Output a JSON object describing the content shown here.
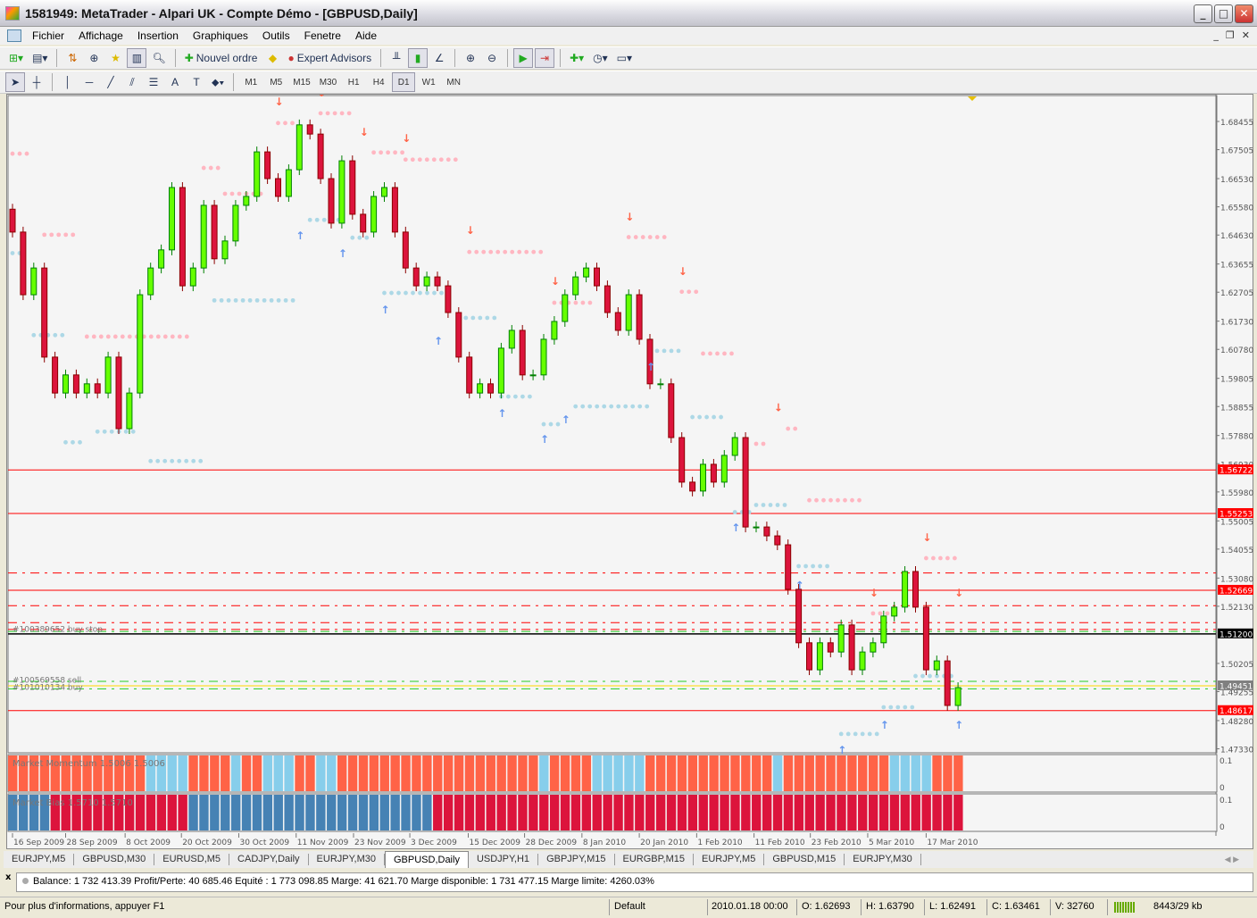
{
  "window": {
    "title": "1581949: MetaTrader - Alpari UK - Compte Démo - [GBPUSD,Daily]"
  },
  "menu": [
    "Fichier",
    "Affichage",
    "Insertion",
    "Graphiques",
    "Outils",
    "Fenetre",
    "Aide"
  ],
  "toolbar": {
    "new_order": "Nouvel ordre",
    "expert_advisors": "Expert Advisors"
  },
  "timeframes": [
    "M1",
    "M5",
    "M15",
    "M30",
    "H1",
    "H4",
    "D1",
    "W1",
    "MN"
  ],
  "active_timeframe": "D1",
  "colors": {
    "bull": "#66ff00",
    "bear": "#dc143c",
    "resistance": "#ffb6c1",
    "support": "#add8e6",
    "down_arrow": "#ff6347",
    "up_arrow": "#6495ed",
    "momentum_bear": "#ff6347",
    "momentum_bull": "#87ceeb",
    "bias_bear": "#dc143c",
    "bias_bull": "#4682b4"
  },
  "chart_data": {
    "type": "candlestick",
    "symbol": "GBPUSD",
    "period": "Daily",
    "closes": [
      1.6473,
      1.6262,
      1.6352,
      1.6052,
      1.5931,
      1.5992,
      1.5931,
      1.5962,
      1.5931,
      1.6052,
      1.5811,
      1.5931,
      1.6262,
      1.6352,
      1.6413,
      1.6623,
      1.6292,
      1.6352,
      1.6563,
      1.6383,
      1.6443,
      1.6563,
      1.6593,
      1.6743,
      1.6653,
      1.6593,
      1.6683,
      1.6834,
      1.6803,
      1.6653,
      1.6503,
      1.6713,
      1.6533,
      1.6473,
      1.6593,
      1.6623,
      1.6473,
      1.6352,
      1.6292,
      1.6322,
      1.6292,
      1.6202,
      1.6052,
      1.5931,
      1.5962,
      1.5931,
      1.6082,
      1.6142,
      1.5992,
      1.5992,
      1.6112,
      1.6172,
      1.6262,
      1.6322,
      1.6352,
      1.6292,
      1.6202,
      1.6142,
      1.6262,
      1.6112,
      1.5962,
      1.5962,
      1.5781,
      1.5631,
      1.5601,
      1.5691,
      1.5631,
      1.5721,
      1.5781,
      1.548,
      1.548,
      1.545,
      1.542,
      1.527,
      1.509,
      1.4999,
      1.509,
      1.5059,
      1.515,
      1.4999,
      1.5059,
      1.509,
      1.518,
      1.521,
      1.533,
      1.521,
      1.4999,
      1.5029,
      1.4879,
      1.4939
    ],
    "first_open": 1.655,
    "ylim": [
      1.4705,
      1.691
    ],
    "y_ticks": [
      "1.68455",
      "1.67505",
      "1.66530",
      "1.65580",
      "1.64630",
      "1.63655",
      "1.62705",
      "1.61730",
      "1.60780",
      "1.59805",
      "1.58855",
      "1.57880",
      "1.56930",
      "1.55980",
      "1.55005",
      "1.54055",
      "1.53080",
      "1.52130",
      "1.50205",
      "1.49255",
      "1.48280",
      "1.47330"
    ],
    "x_labels": [
      {
        "i": 0,
        "t": "16 Sep 2009"
      },
      {
        "i": 5,
        "t": "28 Sep 2009"
      },
      {
        "i": 10.6,
        "t": "8 Oct 2009"
      },
      {
        "i": 15.9,
        "t": "20 Oct 2009"
      },
      {
        "i": 21.3,
        "t": "30 Oct 2009"
      },
      {
        "i": 26.7,
        "t": "11 Nov 2009"
      },
      {
        "i": 32.1,
        "t": "23 Nov 2009"
      },
      {
        "i": 37.4,
        "t": "3 Dec 2009"
      },
      {
        "i": 42.9,
        "t": "15 Dec 2009"
      },
      {
        "i": 48.2,
        "t": "28 Dec 2009"
      },
      {
        "i": 53.6,
        "t": "8 Jan 2010"
      },
      {
        "i": 59,
        "t": "20 Jan 2010"
      },
      {
        "i": 64.4,
        "t": "1 Feb 2010"
      },
      {
        "i": 69.8,
        "t": "11 Feb 2010"
      },
      {
        "i": 75.1,
        "t": "23 Feb 2010"
      },
      {
        "i": 80.5,
        "t": "5 Mar 2010"
      },
      {
        "i": 86,
        "t": "17 Mar 2010"
      }
    ],
    "levels": [
      {
        "price": 1.56722,
        "label": "1.56722",
        "style": "solid",
        "color": "#ff0000"
      },
      {
        "price": 1.55253,
        "label": "1.55253",
        "style": "solid",
        "color": "#ff0000"
      },
      {
        "price": 1.52669,
        "label": "1.52669",
        "style": "solid",
        "color": "#ff0000"
      },
      {
        "price": 1.512,
        "label": "1.51200",
        "style": "solid",
        "color": "#000000"
      },
      {
        "price": 1.49451,
        "label": "1.49451",
        "style": "solid",
        "color": "#ffd700",
        "tagcolor": "#808080"
      },
      {
        "price": 1.48617,
        "label": "1.48617",
        "style": "solid",
        "color": "#ff0000"
      }
    ],
    "order_lines": [
      {
        "price": 1.5325,
        "color": "#ff0000"
      },
      {
        "price": 1.5215,
        "color": "#ff0000"
      },
      {
        "price": 1.5158,
        "color": "#ff0000"
      },
      {
        "price": 1.5135,
        "color": "#ff0000"
      },
      {
        "price": 1.5128,
        "color": "#22cc22"
      },
      {
        "price": 1.496,
        "color": "#22cc22"
      },
      {
        "price": 1.4935,
        "color": "#22cc22"
      }
    ],
    "order_labels": [
      {
        "price": 1.5136,
        "text": "#100389652 buy stop"
      },
      {
        "price": 1.4965,
        "text": "#100569558 sell"
      },
      {
        "price": 1.494,
        "text": "#101010134 buy"
      }
    ],
    "resistance": [
      [
        1.6737,
        0,
        2
      ],
      [
        1.6464,
        3,
        6
      ],
      [
        1.6121,
        7,
        17
      ],
      [
        1.6689,
        18,
        20
      ],
      [
        1.6602,
        20,
        24
      ],
      [
        1.684,
        25,
        27
      ],
      [
        1.6873,
        29,
        32
      ],
      [
        1.6741,
        34,
        37
      ],
      [
        1.6717,
        37,
        42
      ],
      [
        1.6406,
        43,
        50
      ],
      [
        1.6235,
        51,
        55
      ],
      [
        1.6456,
        58,
        62
      ],
      [
        1.6272,
        63,
        65
      ],
      [
        1.6064,
        65,
        68
      ],
      [
        1.576,
        70,
        71
      ],
      [
        1.5811,
        73,
        74
      ],
      [
        1.557,
        75,
        80
      ],
      [
        1.5189,
        81,
        83
      ],
      [
        1.5375,
        86,
        89
      ]
    ],
    "support": [
      [
        1.6402,
        0,
        1
      ],
      [
        1.6126,
        2,
        5
      ],
      [
        1.5765,
        5,
        7
      ],
      [
        1.5801,
        8,
        12
      ],
      [
        1.5702,
        13,
        18
      ],
      [
        1.6243,
        19,
        27
      ],
      [
        1.6514,
        28,
        31
      ],
      [
        1.6454,
        32,
        34
      ],
      [
        1.6268,
        35,
        41
      ],
      [
        1.6184,
        42,
        46
      ],
      [
        1.5919,
        46,
        49
      ],
      [
        1.5826,
        50,
        52
      ],
      [
        1.5886,
        53,
        60
      ],
      [
        1.6073,
        60,
        63
      ],
      [
        1.585,
        64,
        67
      ],
      [
        1.553,
        68,
        70
      ],
      [
        1.5554,
        70,
        73
      ],
      [
        1.5348,
        74,
        77
      ],
      [
        1.4783,
        78,
        82
      ],
      [
        1.4873,
        82,
        85
      ],
      [
        1.4978,
        85,
        89
      ]
    ],
    "down_arrows": [
      [
        25,
        1.69
      ],
      [
        29,
        1.693
      ],
      [
        33,
        1.6797
      ],
      [
        37,
        1.6776
      ],
      [
        43,
        1.6467
      ],
      [
        51,
        1.6295
      ],
      [
        58,
        1.6512
      ],
      [
        63,
        1.6329
      ],
      [
        72,
        1.5869
      ],
      [
        81,
        1.5246
      ],
      [
        86,
        1.5432
      ],
      [
        89,
        1.5246
      ]
    ],
    "up_arrows": [
      [
        27,
        1.6461
      ],
      [
        31,
        1.6401
      ],
      [
        35,
        1.6211
      ],
      [
        40,
        1.6106
      ],
      [
        46,
        1.5862
      ],
      [
        50,
        1.5775
      ],
      [
        52,
        1.5841
      ],
      [
        60,
        1.6019
      ],
      [
        68,
        1.5477
      ],
      [
        74,
        1.5284
      ],
      [
        78,
        1.4728
      ],
      [
        82,
        1.4813
      ],
      [
        89,
        1.4813
      ]
    ],
    "indicators": [
      {
        "name": "Market Momentum 1.5006 1.5006",
        "scale_top": "0.1",
        "scale_bottom": "0",
        "segments": [
          [
            "bear",
            13
          ],
          [
            "bull",
            4
          ],
          [
            "bear",
            4
          ],
          [
            "bull",
            1
          ],
          [
            "bear",
            2
          ],
          [
            "bull",
            3
          ],
          [
            "bear",
            2
          ],
          [
            "bull",
            2
          ],
          [
            "bear",
            19
          ],
          [
            "bull",
            1
          ],
          [
            "bear",
            4
          ],
          [
            "bull",
            5
          ],
          [
            "bear",
            12
          ],
          [
            "bull",
            1
          ],
          [
            "bear",
            10
          ],
          [
            "bull",
            4
          ],
          [
            "bear",
            3
          ]
        ],
        "palette": "momentum"
      },
      {
        "name": "Market Bias 1.5710 1.5710",
        "scale_top": "0.1",
        "scale_bottom": "0",
        "segments": [
          [
            "bull",
            4
          ],
          [
            "bear",
            13
          ],
          [
            "bull",
            23
          ],
          [
            "bear",
            50
          ]
        ],
        "palette": "bias"
      }
    ]
  },
  "tabs": [
    "EURJPY,M5",
    "GBPUSD,M30",
    "EURUSD,M5",
    "CADJPY,Daily",
    "EURJPY,M30",
    "GBPUSD,Daily",
    "USDJPY,H1",
    "GBPJPY,M15",
    "EURGBP,M15",
    "EURJPY,M5",
    "GBPUSD,M15",
    "EURJPY,M30"
  ],
  "active_tab": "GBPUSD,Daily",
  "terminal": {
    "summary": "Balance: 1 732 413.39  Profit/Perte: 40 685.46  Equité : 1 773 098.85  Marge: 41 621.70  Marge disponible: 1 731 477.15  Marge limite: 4260.03%"
  },
  "status": {
    "help": "Pour plus d'informations, appuyer F1",
    "profile": "Default",
    "datetime": "2010.01.18 00:00",
    "open": "O: 1.62693",
    "high": "H: 1.63790",
    "low": "L: 1.62491",
    "close": "C: 1.63461",
    "volume": "V: 32760",
    "traffic": "8443/29 kb"
  }
}
